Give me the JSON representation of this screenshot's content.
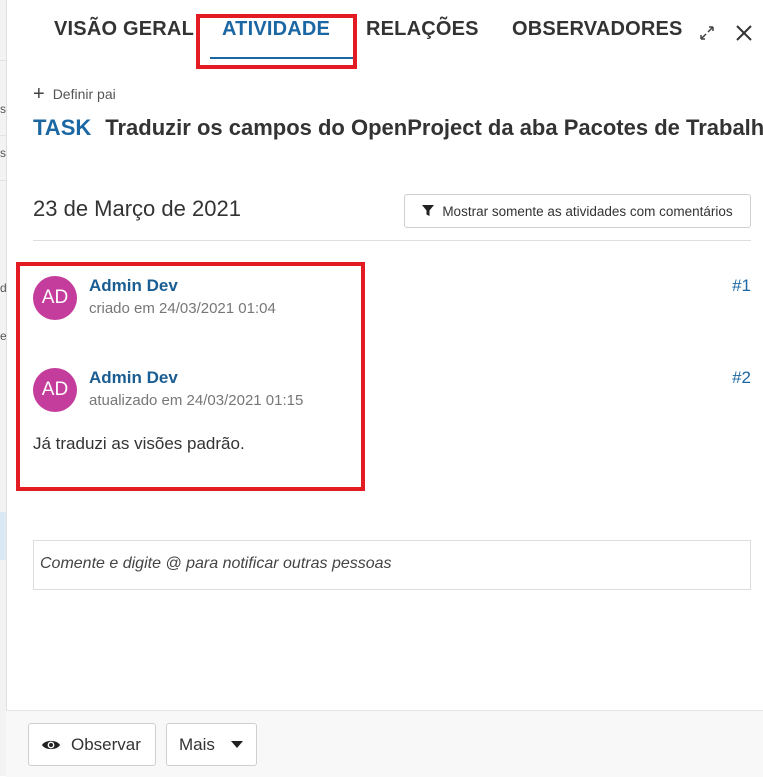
{
  "tabs": {
    "overview": "VISÃO GERAL",
    "activity": "ATIVIDADE",
    "relations": "RELAÇÕES",
    "watchers": "OBSERVADORES"
  },
  "header_icons": [
    "expand-icon",
    "close-icon"
  ],
  "set_parent": "Definir pai",
  "work_package": {
    "type": "TASK",
    "subject": "Traduzir os campos do OpenProject da aba Pacotes de Trabalho"
  },
  "date_heading": "23 de Março de 2021",
  "filter_button": "Mostrar somente as atividades com comentários",
  "activities": [
    {
      "initials": "AD",
      "author": "Admin Dev",
      "meta": "criado em 24/03/2021 01:04",
      "number": "#1",
      "comment": ""
    },
    {
      "initials": "AD",
      "author": "Admin Dev",
      "meta": "atualizado em 24/03/2021 01:15",
      "number": "#2",
      "comment": "Já traduzi as visões padrão."
    }
  ],
  "comment_placeholder": "Comente e digite @ para notificar outras pessoas",
  "footer": {
    "watch": "Observar",
    "more": "Mais"
  },
  "left_fragments": [
    "s",
    "s",
    "d",
    "e"
  ],
  "colors": {
    "accent": "#1a67a3",
    "avatar": "#c43c9c",
    "highlight": "#e31b23"
  }
}
